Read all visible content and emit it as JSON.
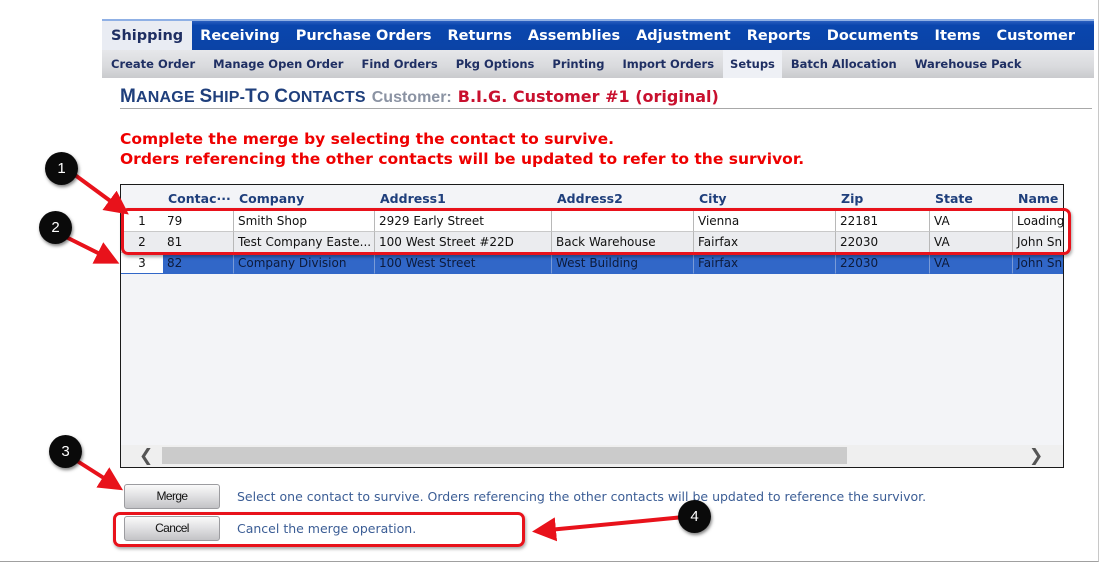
{
  "nav": {
    "top_tabs": [
      {
        "label": "Shipping",
        "active": true
      },
      {
        "label": "Receiving",
        "active": false
      },
      {
        "label": "Purchase Orders",
        "active": false
      },
      {
        "label": "Returns",
        "active": false
      },
      {
        "label": "Assemblies",
        "active": false
      },
      {
        "label": "Adjustment",
        "active": false
      },
      {
        "label": "Reports",
        "active": false
      },
      {
        "label": "Documents",
        "active": false
      },
      {
        "label": "Items",
        "active": false
      },
      {
        "label": "Customer",
        "active": false
      }
    ],
    "sub_tabs": [
      {
        "label": "Create Order",
        "active": false
      },
      {
        "label": "Manage Open Order",
        "active": false
      },
      {
        "label": "Find Orders",
        "active": false
      },
      {
        "label": "Pkg Options",
        "active": false
      },
      {
        "label": "Printing",
        "active": false
      },
      {
        "label": "Import Orders",
        "active": false
      },
      {
        "label": "Setups",
        "active": true
      },
      {
        "label": "Batch Allocation",
        "active": false
      },
      {
        "label": "Warehouse Pack",
        "active": false
      }
    ]
  },
  "header": {
    "title_parts": [
      "M",
      "ANAGE ",
      "S",
      "HIP-",
      "T",
      "O ",
      "C",
      "ONTACTS"
    ],
    "customer_label": "Customer:",
    "customer_name": "B.I.G. Customer #1 (original)"
  },
  "instructions": {
    "line1": "Complete the merge by selecting the contact to survive.",
    "line2": "Orders referencing the other contacts will be updated to refer to the survivor."
  },
  "grid": {
    "columns": [
      "",
      "Contac···",
      "Company",
      "Address1",
      "Address2",
      "City",
      "Zip",
      "State",
      "Name"
    ],
    "rows": [
      {
        "num": "1",
        "contact": "79",
        "company": "Smith Shop",
        "address1": "2929 Early Street",
        "address2": "",
        "city": "Vienna",
        "zip": "22181",
        "state": "VA",
        "name": "Loading",
        "selected": false
      },
      {
        "num": "2",
        "contact": "81",
        "company": "Test Company Easte...",
        "address1": "100 West Street #22D",
        "address2": "Back Warehouse",
        "city": "Fairfax",
        "zip": "22030",
        "state": "VA",
        "name": "John Sn",
        "selected": false
      },
      {
        "num": "3",
        "contact": "82",
        "company": "Company Division",
        "address1": "100 West Street",
        "address2": "West Building",
        "city": "Fairfax",
        "zip": "22030",
        "state": "VA",
        "name": "John Sn",
        "selected": true
      }
    ],
    "scroll_left_icon": "❮",
    "scroll_right_icon": "❯"
  },
  "actions": {
    "merge_label": "Merge",
    "merge_desc": "Select one contact to survive. Orders referencing the other contacts will be updated to reference the survivor.",
    "cancel_label": "Cancel",
    "cancel_desc": "Cancel the merge operation."
  },
  "annotations": {
    "callouts": [
      "1",
      "2",
      "3",
      "4"
    ],
    "color": "#e8121b"
  },
  "colors": {
    "nav_blue": "#0b43a6",
    "selected_row": "#3167c8",
    "warning_red": "#ee0000",
    "title_blue": "#1f3f7c"
  }
}
